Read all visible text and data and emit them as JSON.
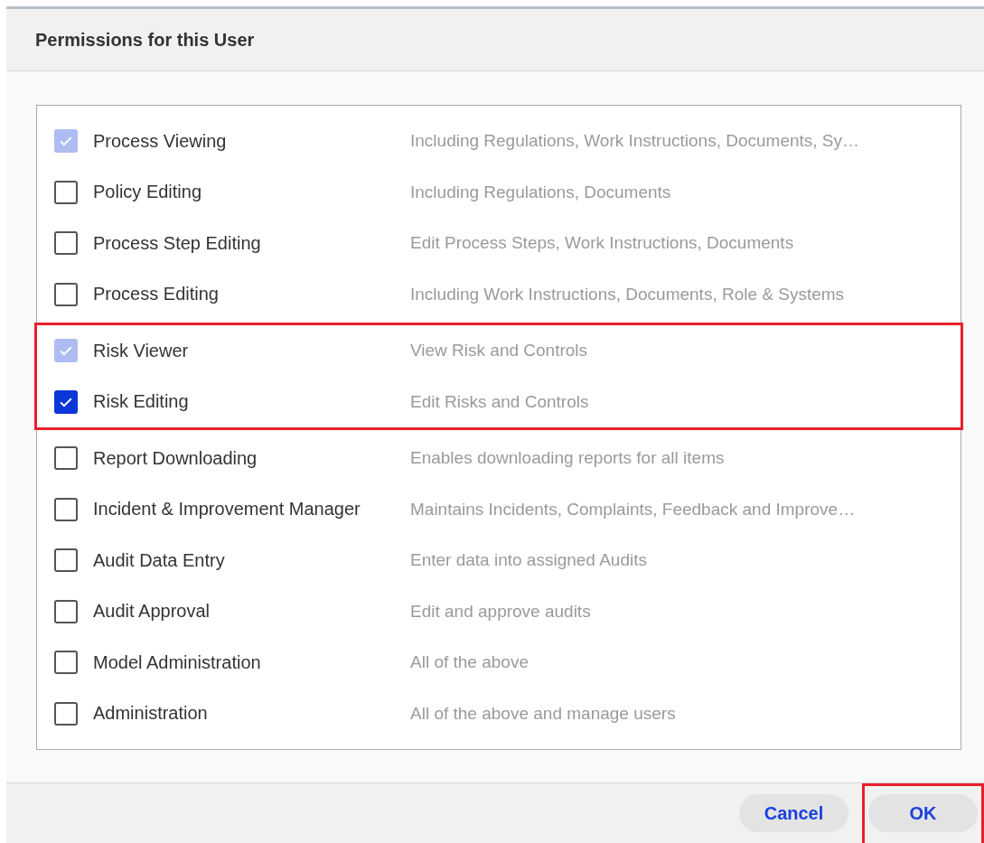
{
  "dialog": {
    "title": "Permissions for this User"
  },
  "permission_sections": [
    {
      "highlighted": false,
      "rows": [
        {
          "label": "Process Viewing",
          "description": "Including Regulations, Work Instructions, Documents, Sy…",
          "checked": true,
          "disabled": true
        },
        {
          "label": "Policy Editing",
          "description": "Including Regulations, Documents",
          "checked": false,
          "disabled": false
        },
        {
          "label": "Process Step Editing",
          "description": "Edit Process Steps, Work Instructions, Documents",
          "checked": false,
          "disabled": false
        },
        {
          "label": "Process Editing",
          "description": "Including Work Instructions, Documents, Role & Systems",
          "checked": false,
          "disabled": false
        }
      ]
    },
    {
      "highlighted": true,
      "rows": [
        {
          "label": "Risk Viewer",
          "description": "View Risk and Controls",
          "checked": true,
          "disabled": true
        },
        {
          "label": "Risk Editing",
          "description": "Edit Risks and Controls",
          "checked": true,
          "disabled": false
        }
      ]
    },
    {
      "highlighted": false,
      "rows": [
        {
          "label": "Report Downloading",
          "description": "Enables downloading reports for all items",
          "checked": false,
          "disabled": false
        },
        {
          "label": "Incident & Improvement Manager",
          "description": "Maintains Incidents, Complaints, Feedback and Improve…",
          "checked": false,
          "disabled": false
        },
        {
          "label": "Audit Data Entry",
          "description": "Enter data into assigned Audits",
          "checked": false,
          "disabled": false
        },
        {
          "label": "Audit Approval",
          "description": "Edit and approve audits",
          "checked": false,
          "disabled": false
        },
        {
          "label": "Model Administration",
          "description": "All of the above",
          "checked": false,
          "disabled": false
        },
        {
          "label": "Administration",
          "description": "All of the above and manage users",
          "checked": false,
          "disabled": false
        }
      ]
    }
  ],
  "buttons": [
    {
      "label": "Cancel",
      "highlighted": false
    },
    {
      "label": "OK",
      "highlighted": true
    }
  ]
}
